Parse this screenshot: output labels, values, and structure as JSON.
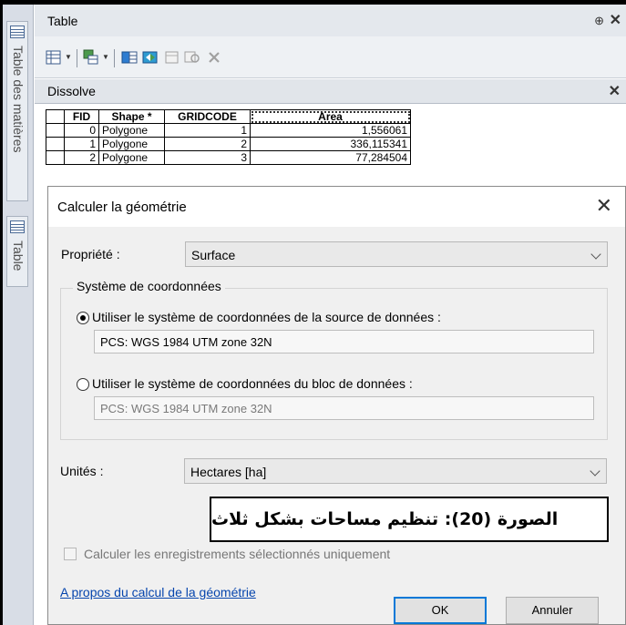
{
  "side_panel": {
    "tab1_label": "Table des matières",
    "tab2_label": "Table"
  },
  "table_window": {
    "title": "Table",
    "pin_glyph": "⊕",
    "close_glyph": "✕",
    "toolbar_icons": [
      "table-options-icon",
      "related-tables-icon",
      "select-by-attributes-icon",
      "switch-selection-icon",
      "clear-selection-icon",
      "zoom-to-selected-icon",
      "delete-selected-icon"
    ],
    "layer_tab": "Dissolve",
    "columns": [
      "FID",
      "Shape *",
      "GRIDCODE",
      "Area"
    ],
    "rows": [
      {
        "fid": "0",
        "shape": "Polygone",
        "gridcode": "1",
        "area": "1,556061"
      },
      {
        "fid": "1",
        "shape": "Polygone",
        "gridcode": "2",
        "area": "336,115341"
      },
      {
        "fid": "2",
        "shape": "Polygone",
        "gridcode": "3",
        "area": "77,284504"
      }
    ]
  },
  "dialog": {
    "title": "Calculer la géométrie",
    "property_label": "Propriété :",
    "property_value": "Surface",
    "coord_group_label": "Système de coordonnées",
    "radio1_label": "Utiliser le système de coordonnées de la source de données :",
    "radio1_value": "PCS: WGS 1984 UTM zone 32N",
    "radio2_label": "Utiliser le système de coordonnées du bloc de données :",
    "radio2_value": "PCS: WGS 1984 UTM zone 32N",
    "units_label": "Unités :",
    "units_value": "Hectares [ha]",
    "checkbox_label": "Calculer les enregistrements sélectionnés uniquement",
    "help_link": "A propos du calcul de la géométrie",
    "ok_label": "OK",
    "cancel_label": "Annuler"
  },
  "caption": {
    "text": "الصورة (20): تنظيم مساحات بشكل ثلاث"
  },
  "colors": {
    "side_strip": "#d8dde6",
    "dialog_bg": "#f0f0f0",
    "default_button_border": "#0078d7",
    "link": "#0645ad"
  }
}
